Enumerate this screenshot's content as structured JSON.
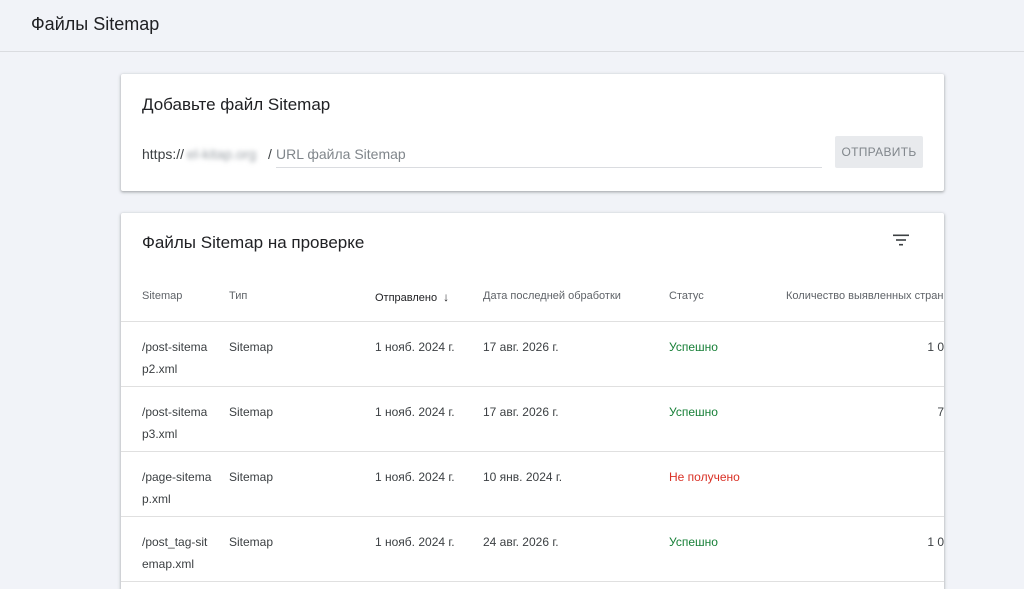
{
  "header": {
    "title": "Файлы Sitemap"
  },
  "add_card": {
    "title": "Добавьте файл Sitemap",
    "url_prefix": "https://",
    "domain_blurred": "el-kitap.org",
    "url_slash": "/",
    "input_placeholder": "URL файла Sitemap",
    "submit_label": "ОТПРАВИТЬ"
  },
  "list_card": {
    "title": "Файлы Sitemap на проверке",
    "columns": {
      "sitemap": "Sitemap",
      "type": "Тип",
      "submitted": "Отправлено",
      "last_read": "Дата последней обработки",
      "status": "Статус",
      "discovered": "Количество выявленных стран"
    },
    "rows": [
      {
        "path": "/post-sitemap2.xml",
        "type": "Sitemap",
        "submitted": "1 нояб. 2024 г.",
        "last_read": "17 авг. 2026 г.",
        "status": "Успешно",
        "status_kind": "ok",
        "count": "1 0"
      },
      {
        "path": "/post-sitemap3.xml",
        "type": "Sitemap",
        "submitted": "1 нояб. 2024 г.",
        "last_read": "17 авг. 2026 г.",
        "status": "Успешно",
        "status_kind": "ok",
        "count": "7"
      },
      {
        "path": "/page-sitemap.xml",
        "type": "Sitemap",
        "submitted": "1 нояб. 2024 г.",
        "last_read": "10 янв. 2024 г.",
        "status": "Не получено",
        "status_kind": "err",
        "count": ""
      },
      {
        "path": "/post_tag-sitemap.xml",
        "type": "Sitemap",
        "submitted": "1 нояб. 2024 г.",
        "last_read": "24 авг. 2026 г.",
        "status": "Успешно",
        "status_kind": "ok",
        "count": "1 0"
      }
    ]
  },
  "colors": {
    "success": "#188038",
    "error": "#d93025",
    "background": "#f1f3f8"
  }
}
